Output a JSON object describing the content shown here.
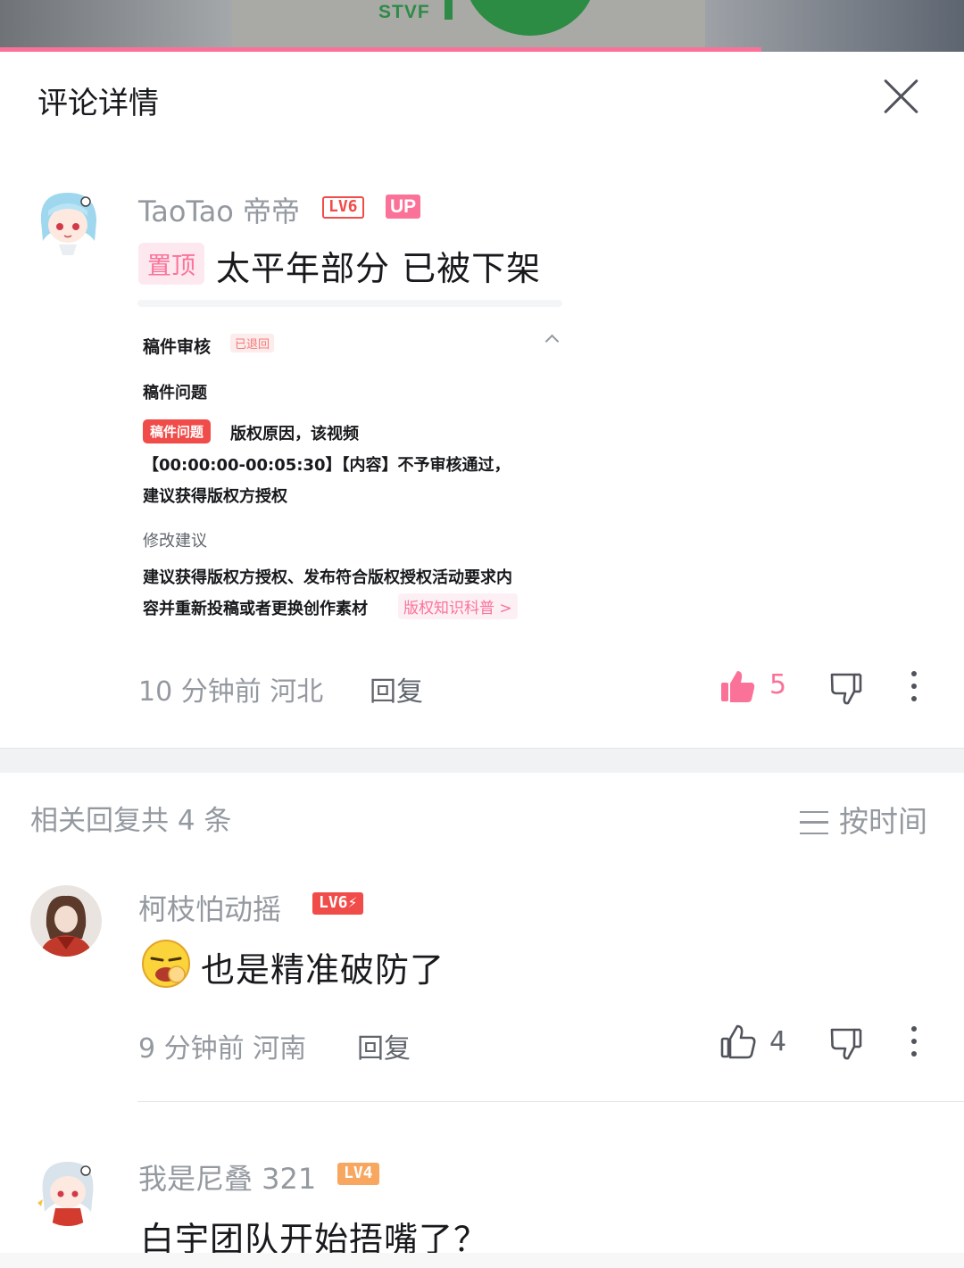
{
  "video": {
    "overlay_text": "STVF",
    "progress": 0.79,
    "accent": "#fb7299",
    "logo_green": "#2f8a47"
  },
  "panel": {
    "title": "评论详情",
    "close_icon": "close-icon"
  },
  "root_comment": {
    "username": "TaoTao 帝帝",
    "level": "LV6",
    "up_badge": "UP",
    "pin_tag": "置顶",
    "text": "太平年部分  已被下架",
    "review_card": {
      "title": "稿件审核",
      "status": "已退回",
      "issue_label": "稿件问题",
      "issue_tag": "稿件问题",
      "issue_lines": [
        "版权原因，该视频",
        "【00:00:00-00:05:30】【内容】不予审核通过，",
        "建议获得版权方授权"
      ],
      "suggestion_label": "修改建议",
      "suggestion_lines": [
        "建议获得版权方授权、发布符合版权授权活动要求内",
        "容并重新投稿或者更换创作素材"
      ],
      "link": "版权知识科普 >"
    },
    "meta": "10 分钟前  河北",
    "reply_label": "回复",
    "likes": "5",
    "liked": true
  },
  "replies_header": {
    "count_text": "相关回复共 4 条",
    "sort_label": "按时间"
  },
  "replies": [
    {
      "username": "柯枝怕动摇",
      "level": "LV6⚡",
      "text": "也是精准破防了",
      "meta": "9 分钟前  河南",
      "reply_label": "回复",
      "likes": "4"
    },
    {
      "username": "我是尼叠 321",
      "level": "LV4",
      "text": "白宇团队开始捂嘴了？"
    }
  ]
}
